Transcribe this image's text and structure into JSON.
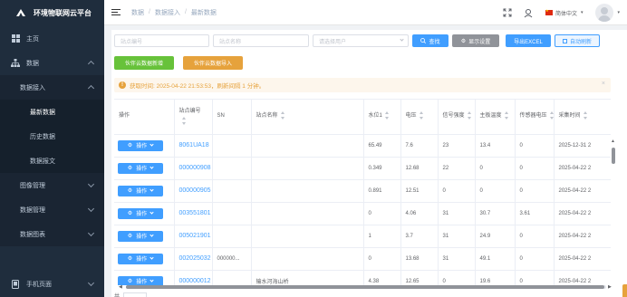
{
  "app": {
    "title": "环境物联网云平台"
  },
  "sidebar": {
    "items": [
      {
        "label": "主页",
        "icon": "dashboard-icon"
      },
      {
        "label": "数据",
        "icon": "sitemap-icon",
        "expanded": true
      },
      {
        "label": "数据接入",
        "expanded": true
      },
      {
        "label": "最新数据",
        "active": true
      },
      {
        "label": "历史数据"
      },
      {
        "label": "数据报文"
      },
      {
        "label": "图像管理"
      },
      {
        "label": "数据管理"
      },
      {
        "label": "数据图表"
      },
      {
        "label": "手机页面",
        "icon": "mobile-icon"
      }
    ]
  },
  "header": {
    "breadcrumb": [
      "数据",
      "数据接入",
      "最新数据"
    ],
    "language": "简体中文"
  },
  "toolbar": {
    "station_code_placeholder": "站点编号",
    "station_name_placeholder": "站点名称",
    "user_placeholder": "请选择用户",
    "search_label": "查找",
    "display_settings_label": "显示设置",
    "export_label": "导出EXCEL",
    "auto_refresh_label": "自动刷新",
    "add_label": "伙伴云数据新增",
    "import_label": "伙伴云数据导入"
  },
  "alert": {
    "text": "获取时间: 2025-04-22 21:53:53，刷新间隔 1 分钟。"
  },
  "table": {
    "headers": {
      "op": "操作",
      "code": "站点编号",
      "sn": "SN",
      "name": "站点名称",
      "water": "水位1",
      "voltage": "电压",
      "signal": "信号强度",
      "board_temp": "主板温度",
      "sensor_v": "传感器电压",
      "time": "采集时间"
    },
    "op_label": "操作",
    "rows": [
      {
        "code": "8061UA18",
        "sn": "",
        "name": "",
        "water": "65.49",
        "voltage": "7.6",
        "signal": "23",
        "board_temp": "13.4",
        "sensor_v": "0",
        "time": "2025-12-31 2"
      },
      {
        "code": "000000908",
        "sn": "",
        "name": "",
        "water": "0.349",
        "voltage": "12.68",
        "signal": "22",
        "board_temp": "0",
        "sensor_v": "0",
        "time": "2025-04-22 2"
      },
      {
        "code": "000000905",
        "sn": "",
        "name": "",
        "water": "0.891",
        "voltage": "12.51",
        "signal": "0",
        "board_temp": "0",
        "sensor_v": "0",
        "time": "2025-04-22 2"
      },
      {
        "code": "003551801",
        "sn": "",
        "name": "",
        "water": "0",
        "voltage": "4.06",
        "signal": "31",
        "board_temp": "30.7",
        "sensor_v": "3.61",
        "time": "2025-04-22 2"
      },
      {
        "code": "005021901",
        "sn": "",
        "name": "",
        "water": "1",
        "voltage": "3.7",
        "signal": "31",
        "board_temp": "24.9",
        "sensor_v": "0",
        "time": "2025-04-22 2"
      },
      {
        "code": "002025032",
        "sn": "000000...",
        "name": "",
        "water": "0",
        "voltage": "13.68",
        "signal": "31",
        "board_temp": "49.1",
        "sensor_v": "0",
        "time": "2025-04-22 2"
      },
      {
        "code": "000000012",
        "sn": "",
        "name": "输水河海山桥",
        "water": "4.38",
        "voltage": "12.65",
        "signal": "0",
        "board_temp": "19.6",
        "sensor_v": "0",
        "time": "2025-04-22 2"
      }
    ]
  },
  "pager": {
    "prefix": "共"
  },
  "colors": {
    "primary": "#409eff",
    "success": "#67c23a",
    "warning": "#e6a23c",
    "sidebar": "#1f2d3d"
  }
}
